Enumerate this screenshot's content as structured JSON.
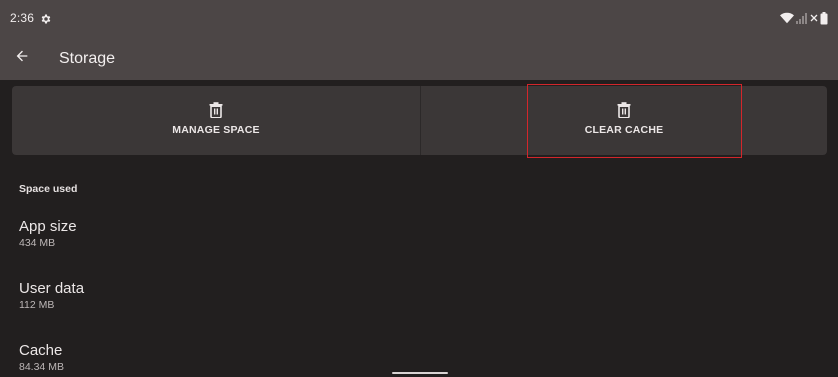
{
  "status_bar": {
    "time": "2:36",
    "icons": [
      "gear-icon",
      "wifi-icon",
      "signal-icon",
      "no-signal-x-icon",
      "battery-icon"
    ]
  },
  "toolbar": {
    "back_icon": "arrow-back-icon",
    "title": "Storage"
  },
  "actions": [
    {
      "label": "MANAGE SPACE",
      "icon": "trash-icon"
    },
    {
      "label": "CLEAR CACHE",
      "icon": "trash-icon",
      "highlighted": true
    }
  ],
  "storage": {
    "section_title": "Space used",
    "items": [
      {
        "title": "App size",
        "summary": "434 MB"
      },
      {
        "title": "User data",
        "summary": "112 MB"
      },
      {
        "title": "Cache",
        "summary": "84.34 MB"
      }
    ]
  },
  "colors": {
    "top_area": "#4c4646",
    "background": "#221f1f",
    "action_bar": "#3b3737",
    "highlight": "#d3262b"
  }
}
